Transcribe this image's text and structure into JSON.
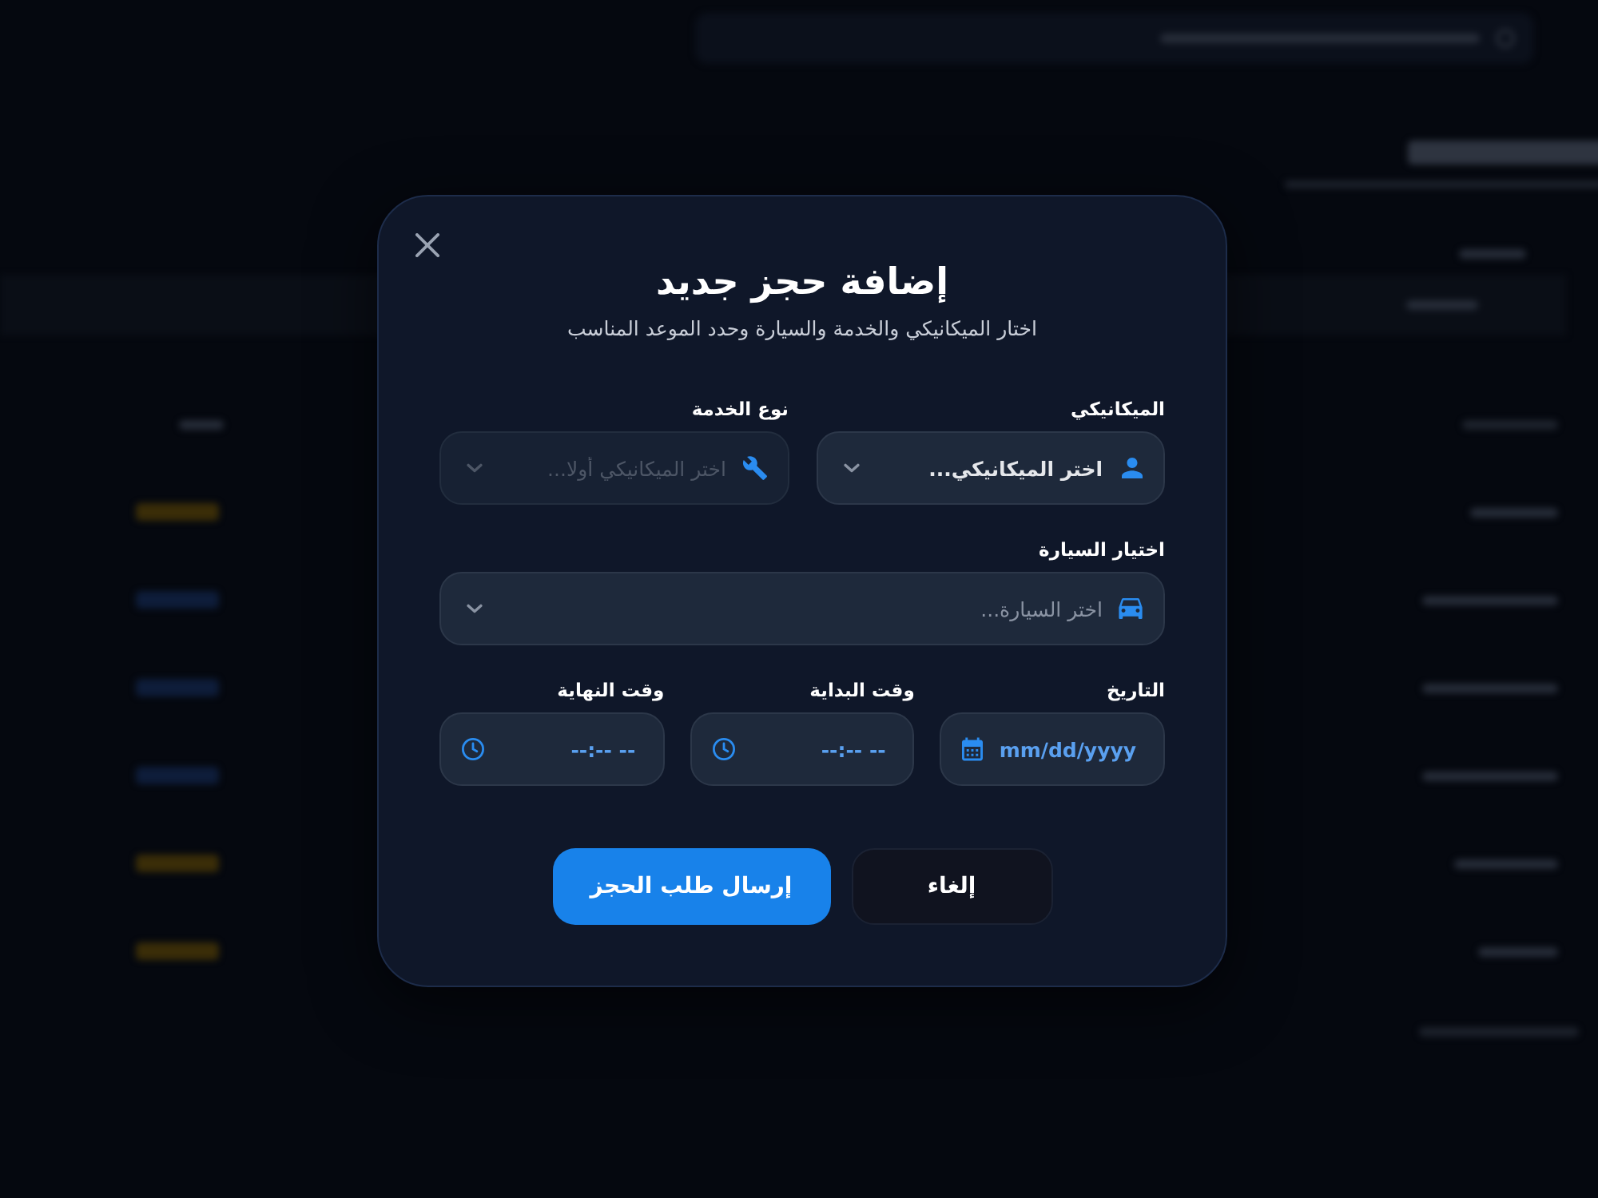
{
  "dialog": {
    "title": "إضافة حجز جديد",
    "subtitle": "اختار الميكانيكي والخدمة والسيارة وحدد الموعد المناسب"
  },
  "form_rows": [
    {
      "fields": [
        {
          "kind": "mechanic",
          "label": "الميكانيكي",
          "value": "اختر الميكانيكي...",
          "disabled": false
        },
        {
          "kind": "service",
          "label": "نوع الخدمة",
          "placeholder": "اختر الميكانيكي أولا...",
          "disabled": true
        }
      ]
    },
    {
      "fields": [
        {
          "kind": "car",
          "label": "اختيار السيارة",
          "placeholder": "اختر السيارة...",
          "disabled": false
        }
      ]
    },
    {
      "fields": [
        {
          "kind": "date",
          "label": "التاريخ",
          "placeholder": "mm/dd/yyyy",
          "disabled": false
        },
        {
          "kind": "time",
          "label": "وقت البداية",
          "placeholder": "--:-- --",
          "disabled": false
        },
        {
          "kind": "time",
          "label": "وقت النهاية",
          "placeholder": "--:-- --",
          "disabled": false
        }
      ]
    }
  ],
  "buttons": [
    {
      "kind": "secondary",
      "label": "إلغاء"
    },
    {
      "kind": "primary",
      "label": "إرسال طلب الحجز"
    }
  ]
}
